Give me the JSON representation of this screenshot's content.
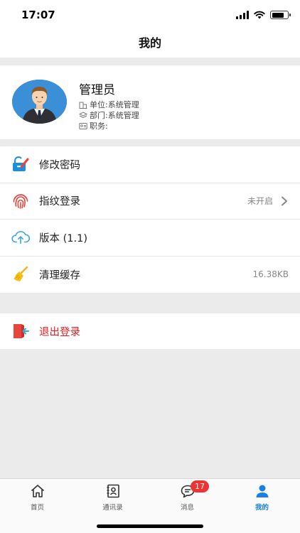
{
  "status_bar": {
    "time": "17:07"
  },
  "nav": {
    "title": "我的"
  },
  "profile": {
    "name": "管理员",
    "unit": "单位:系统管理",
    "department": "部门:系统管理",
    "position": "职务:"
  },
  "menu": {
    "items": [
      {
        "label": "修改密码",
        "value": "",
        "icon": "lock-edit-icon"
      },
      {
        "label": "指纹登录",
        "value": "未开启",
        "icon": "fingerprint-icon"
      },
      {
        "label": "版本 (1.1)",
        "value": "",
        "icon": "cloud-upload-icon"
      },
      {
        "label": "清理缓存",
        "value": "16.38KB",
        "icon": "broom-icon"
      }
    ]
  },
  "logout": {
    "label": "退出登录",
    "icon": "exit-icon"
  },
  "tabs": [
    {
      "label": "首页",
      "icon": "home-icon"
    },
    {
      "label": "通讯录",
      "icon": "contacts-icon"
    },
    {
      "label": "消息",
      "icon": "message-icon",
      "badge": "17"
    },
    {
      "label": "我的",
      "icon": "person-icon",
      "active": true
    }
  ],
  "colors": {
    "accent": "#1a7fe0",
    "danger": "#e02020",
    "badge": "#ee3333"
  }
}
